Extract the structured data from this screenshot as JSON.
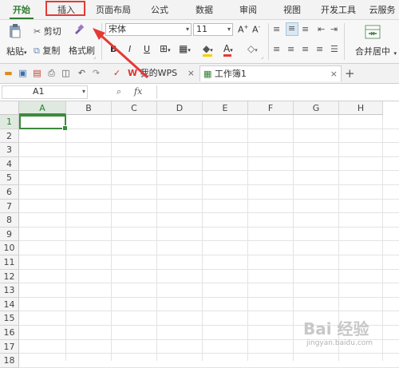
{
  "menubar": {
    "tabs": [
      "开始",
      "插入",
      "页面布局",
      "公式",
      "数据",
      "审阅",
      "视图",
      "开发工具",
      "云服务"
    ],
    "active_tab": "开始"
  },
  "ribbon": {
    "paste_label": "粘贴",
    "cut_label": "剪切",
    "copy_label": "复制",
    "format_painter_label": "格式刷",
    "font_name": "宋体",
    "font_size": "11",
    "bold_label": "B",
    "italic_label": "I",
    "underline_label": "U",
    "merge_center_label": "合并居中"
  },
  "tabbar": {
    "home_tab_label": "我的WPS",
    "doc_tab_label": "工作簿1",
    "close_glyph": "×",
    "new_tab_glyph": "+"
  },
  "formulabar": {
    "cell_ref": "A1",
    "fx_label": "fx"
  },
  "grid": {
    "columns": [
      "A",
      "B",
      "C",
      "D",
      "E",
      "F",
      "G",
      "H"
    ],
    "rows": [
      "1",
      "2",
      "3",
      "4",
      "5",
      "6",
      "7",
      "8",
      "9",
      "10",
      "11",
      "12",
      "13",
      "14",
      "15",
      "16",
      "17",
      "18"
    ],
    "active_cell": "A1"
  },
  "annotation": {
    "arrow_color": "#e53935",
    "highlight_color": "#e53935"
  },
  "watermark": {
    "line1": "Bai 经验",
    "line2": "jingyan.baidu.com"
  },
  "colors": {
    "accent": "#2e7d32",
    "grid": "#e3e3e3"
  }
}
